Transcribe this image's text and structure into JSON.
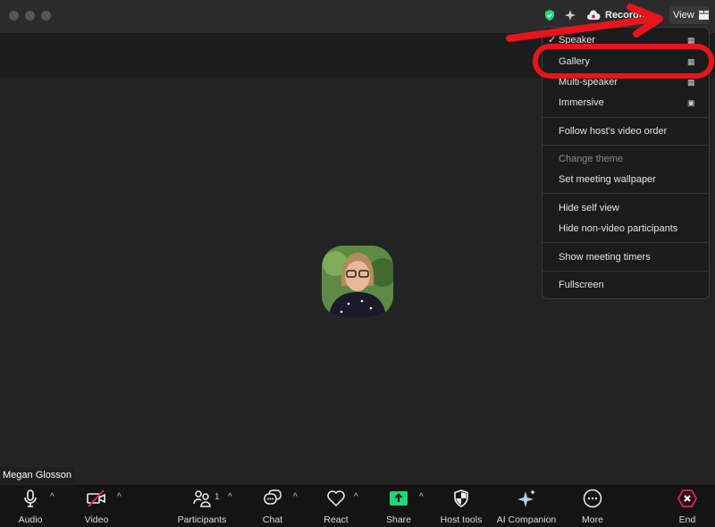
{
  "topbar": {
    "recording_label": "Recording",
    "view_label": "View"
  },
  "menu": {
    "items": [
      {
        "label": "Speaker",
        "checked": true,
        "icon": "grid-icon"
      },
      {
        "label": "Gallery",
        "icon": "grid-icon"
      },
      {
        "label": "Multi-speaker",
        "icon": "grid-icon"
      },
      {
        "label": "Immersive",
        "icon": "immersive-icon"
      },
      {
        "label": "Follow host's video order"
      },
      {
        "label": "Change theme",
        "disabled": true
      },
      {
        "label": "Set meeting wallpaper"
      },
      {
        "label": "Hide self view"
      },
      {
        "label": "Hide non-video participants"
      },
      {
        "label": "Show meeting timers"
      },
      {
        "label": "Fullscreen"
      }
    ]
  },
  "participant": {
    "name": "Megan Glosson"
  },
  "toolbar": {
    "audio": "Audio",
    "video": "Video",
    "participants": "Participants",
    "participants_count": "1",
    "chat": "Chat",
    "react": "React",
    "share": "Share",
    "host_tools": "Host tools",
    "ai_companion": "AI Companion",
    "more": "More",
    "end": "End"
  },
  "colors": {
    "share": "#1fd67a",
    "end": "#e0245e",
    "annotation": "#e8141c",
    "shield": "#1fd67a"
  }
}
